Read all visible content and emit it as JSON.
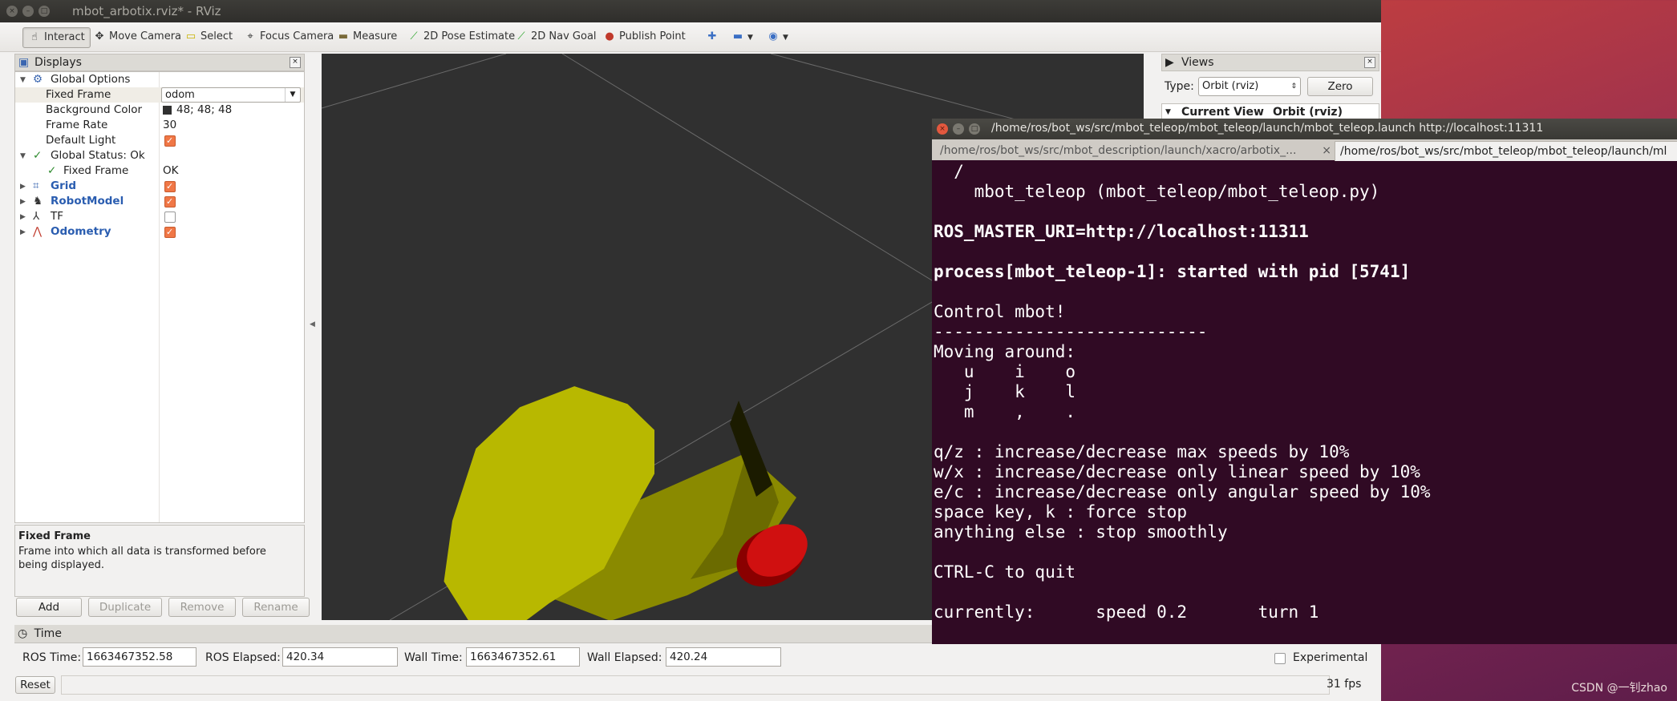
{
  "window": {
    "title": "mbot_arbotix.rviz* - RViz"
  },
  "toolbar": {
    "interact": "Interact",
    "move_camera": "Move Camera",
    "select": "Select",
    "focus_camera": "Focus Camera",
    "measure": "Measure",
    "pose_estimate": "2D Pose Estimate",
    "nav_goal": "2D Nav Goal",
    "publish_point": "Publish Point"
  },
  "displays": {
    "title": "Displays",
    "global_options": "Global Options",
    "fixed_frame_label": "Fixed Frame",
    "fixed_frame_value": "odom",
    "background_color_label": "Background Color",
    "background_color_value": "48; 48; 48",
    "frame_rate_label": "Frame Rate",
    "frame_rate_value": "30",
    "default_light_label": "Default Light",
    "global_status": "Global Status: Ok",
    "status_fixed_frame": "Fixed Frame",
    "status_fixed_frame_value": "OK",
    "grid": "Grid",
    "robot_model": "RobotModel",
    "tf": "TF",
    "odometry": "Odometry"
  },
  "description": {
    "heading": "Fixed Frame",
    "body": "Frame into which all data is transformed before being displayed."
  },
  "buttons": {
    "add": "Add",
    "duplicate": "Duplicate",
    "remove": "Remove",
    "rename": "Rename"
  },
  "views": {
    "title": "Views",
    "type_label": "Type:",
    "type_value": "Orbit (rviz)",
    "zero": "Zero",
    "current_view": "Current View",
    "current_view_value": "Orbit (rviz)"
  },
  "time": {
    "title": "Time",
    "ros_time_label": "ROS Time:",
    "ros_time": "1663467352.58",
    "ros_elapsed_label": "ROS Elapsed:",
    "ros_elapsed": "420.34",
    "wall_time_label": "Wall Time:",
    "wall_time": "1663467352.61",
    "wall_elapsed_label": "Wall Elapsed:",
    "wall_elapsed": "420.24",
    "experimental": "Experimental",
    "reset": "Reset",
    "fps": "31 fps"
  },
  "terminal": {
    "title": "/home/ros/bot_ws/src/mbot_teleop/mbot_teleop/launch/mbot_teleop.launch http://localhost:11311",
    "tab1": "/home/ros/bot_ws/src/mbot_description/launch/xacro/arbotix_...",
    "tab2": "/home/ros/bot_ws/src/mbot_teleop/mbot_teleop/launch/ml",
    "lines": [
      "  /",
      "    mbot_teleop (mbot_teleop/mbot_teleop.py)",
      "",
      "ROS_MASTER_URI=http://localhost:11311",
      "",
      "process[mbot_teleop-1]: started with pid [5741]",
      "",
      "Control mbot!",
      "---------------------------",
      "Moving around:",
      "   u    i    o",
      "   j    k    l",
      "   m    ,    .",
      "",
      "q/z : increase/decrease max speeds by 10%",
      "w/x : increase/decrease only linear speed by 10%",
      "e/c : increase/decrease only angular speed by 10%",
      "space key, k : force stop",
      "anything else : stop smoothly",
      "",
      "CTRL-C to quit",
      "",
      "currently:      speed 0.2       turn 1"
    ]
  },
  "watermark": "CSDN @一钊zhao"
}
